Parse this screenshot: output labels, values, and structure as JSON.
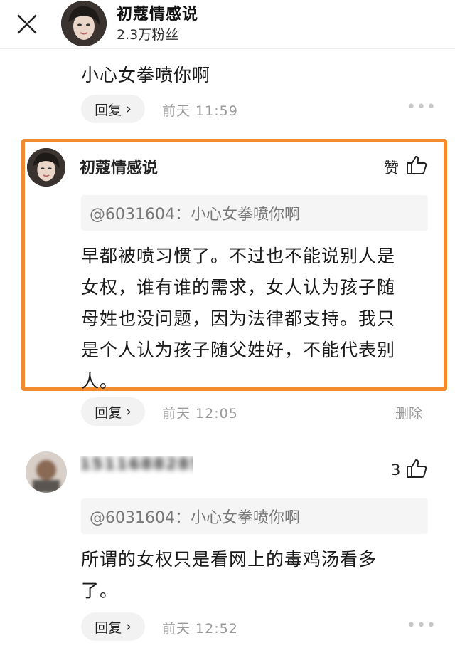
{
  "header": {
    "author_name": "初蔻情感说",
    "fans": "2.3万粉丝"
  },
  "reply_label": "回复",
  "comments": [
    {
      "text": "小心女拳喷你啊",
      "time": "前天 11:59"
    },
    {
      "author": "初蔻情感说",
      "like_label": "赞",
      "quote": "@6031604：小心女拳喷你啊",
      "text_lines": [
        "早都被喷习惯了。不过也不能说别人是",
        "女权，谁有谁的需求，女人认为孩子随",
        "母姓也没问题，因为法律都支持。我只",
        "是个人认为孩子随父姓好，不能代表别",
        "人。"
      ],
      "time": "前天 12:05",
      "delete_label": "删除"
    },
    {
      "author": "15116882851",
      "like_count": "3",
      "quote": "@6031604：小心女拳喷你啊",
      "text_lines": [
        "所谓的女权只是看网上的毒鸡汤看多",
        "了。"
      ],
      "time": "前天 12:52"
    }
  ],
  "colors": {
    "highlight_border": "#f28a2e",
    "pill_bg": "#f2f2f2",
    "quote_bg": "#f5f5f5"
  }
}
